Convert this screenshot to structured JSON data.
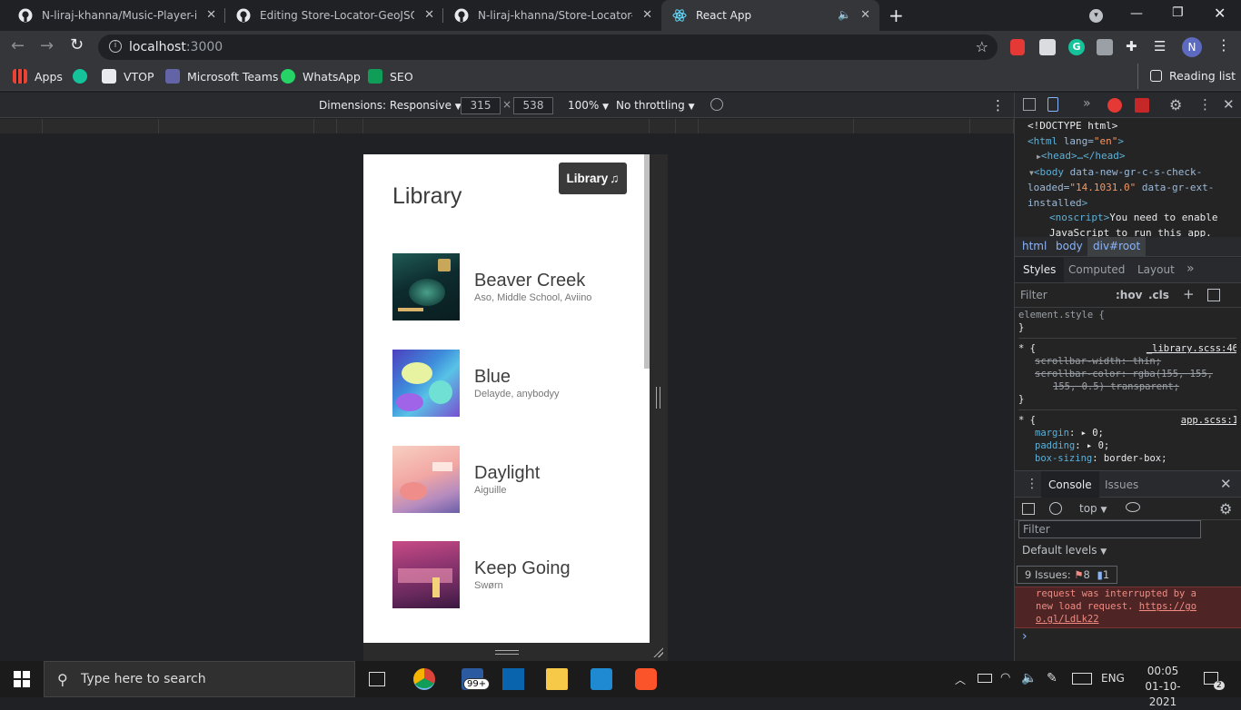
{
  "browser": {
    "tabs": [
      {
        "title": "N-liraj-khanna/Music-Player-in-R",
        "icon": "github-icon"
      },
      {
        "title": "Editing Store-Locator-GeoJSON/R",
        "icon": "github-icon"
      },
      {
        "title": "N-liraj-khanna/Store-Locator-Ge",
        "icon": "github-icon"
      },
      {
        "title": "React App",
        "icon": "react-icon",
        "active": true
      }
    ],
    "address": {
      "host": "localhost",
      "port": ":3000"
    },
    "profile_initial": "N",
    "bookmarks": [
      "Apps",
      "VTOP",
      "Microsoft Teams",
      "WhatsApp",
      "SEO"
    ],
    "reading_list": "Reading list"
  },
  "device_toolbar": {
    "dimensions_label": "Dimensions: Responsive",
    "width": "315",
    "height": "538",
    "times": "×",
    "zoom": "100%",
    "throttling": "No throttling"
  },
  "app": {
    "title": "Library",
    "library_button": "Library",
    "songs": [
      {
        "name": "Beaver Creek",
        "artist": "Aso, Middle School, Aviino",
        "colors": [
          "#0f3a3a",
          "#2f7d6e",
          "#c9a75a"
        ]
      },
      {
        "name": "Blue",
        "artist": "Delayde, anybodyy",
        "colors": [
          "#4d3fbf",
          "#58c3e6",
          "#e8f3a2"
        ]
      },
      {
        "name": "Daylight",
        "artist": "Aiguille",
        "colors": [
          "#f2a7a3",
          "#f7cfc2",
          "#6a5ea8"
        ]
      },
      {
        "name": "Keep Going",
        "artist": "Swørn",
        "colors": [
          "#6b2a5e",
          "#c84b86",
          "#f19ab7"
        ]
      }
    ]
  },
  "devtools": {
    "elements": {
      "line1": "<!DOCTYPE html>",
      "line2_tag": "<html",
      "line2_attr": " lang=",
      "line2_val": "\"en\"",
      "line2_end": ">",
      "line3": "<head>…</head>",
      "line4_tag": "<body",
      "line4_attr": " data-new-gr-c-s-check-",
      "line4_attr2": "loaded=",
      "line4_val": "\"14.1031.0\"",
      "line4_attr3": " data-gr-ext-",
      "line4_attr4": "installed",
      "line4_end": ">",
      "line5_tag": "<noscript>",
      "line5_text": "You need to enable",
      "line6_text": "JavaScript to run this app."
    },
    "breadcrumbs": [
      "html",
      "body",
      "div#root"
    ],
    "style_tabs": [
      "Styles",
      "Computed",
      "Layout"
    ],
    "filter_placeholder": "Filter",
    "hov": ":hov",
    "cls": ".cls",
    "element_style": "element.style {",
    "close_brace": "}",
    "rule1": {
      "selector": "* {",
      "source": "_library.scss:46",
      "decl1": "scrollbar-width: thin;",
      "decl2": "scrollbar-color: rgba(155, 155,",
      "decl3": "155, 0.5) transparent;"
    },
    "rule2": {
      "selector": "* {",
      "source": "app.scss:1",
      "decl1_prop": "margin",
      "decl1_val": "0;",
      "decl2_prop": "padding",
      "decl2_val": "0;",
      "decl3_prop": "box-sizing",
      "decl3_val": "border-box;"
    },
    "drawer_tabs": [
      "Console",
      "Issues"
    ],
    "console_context": "top",
    "console_filter_placeholder": "Filter",
    "default_levels": "Default levels",
    "issues": {
      "label": "9 Issues:",
      "errors": "8",
      "info": "1"
    },
    "error_message_1": "request was interrupted by a",
    "error_message_2": "new load request.",
    "error_link_1": "https://go",
    "error_link_2": "o.gl/LdLk22",
    "prompt": "›"
  },
  "taskbar": {
    "search_placeholder": "Type here to search",
    "mail_badge": "99+",
    "language": "ENG",
    "time": "00:05",
    "date": "01-10-2021",
    "notification_count": "2"
  }
}
